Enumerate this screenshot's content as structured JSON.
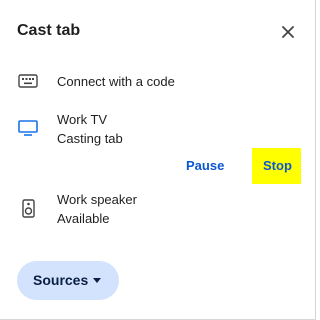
{
  "dialog": {
    "title": "Cast tab",
    "close_icon": "close-icon"
  },
  "items": [
    {
      "icon": "keyboard-icon",
      "primary": "Connect with a code",
      "secondary": ""
    },
    {
      "icon": "tv-icon",
      "primary": "Work TV",
      "secondary": "Casting tab",
      "actions": {
        "pause_label": "Pause",
        "stop_label": "Stop"
      }
    },
    {
      "icon": "speaker-icon",
      "primary": "Work speaker",
      "secondary": "Available"
    }
  ],
  "sources": {
    "label": "Sources",
    "icon": "caret-down-icon"
  },
  "colors": {
    "accent": "#0b57d0",
    "tv_icon": "#1a73e8",
    "sources_bg": "#d3e3fd",
    "stop_highlight": "#ffff00"
  }
}
